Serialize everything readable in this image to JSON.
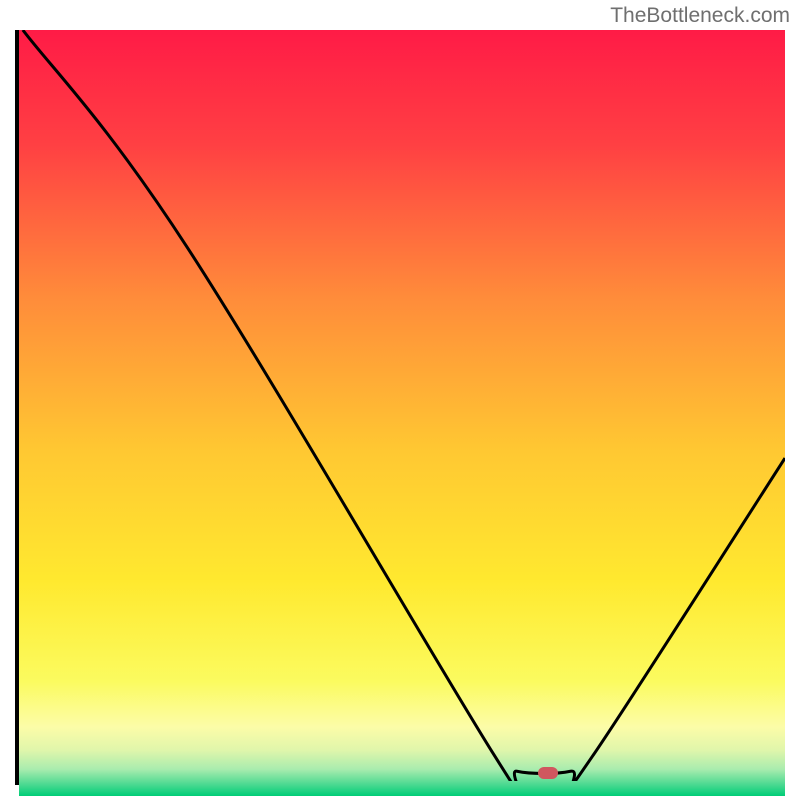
{
  "watermark": "TheBottleneck.com",
  "chart_data": {
    "type": "line",
    "title": "",
    "xlabel": "",
    "ylabel": "",
    "x_range": [
      0,
      100
    ],
    "y_range": [
      0,
      100
    ],
    "series": [
      {
        "name": "bottleneck-curve",
        "points": [
          {
            "x": 0.5,
            "y": 100
          },
          {
            "x": 22,
            "y": 71
          },
          {
            "x": 62,
            "y": 3.5
          },
          {
            "x": 65,
            "y": 1.3
          },
          {
            "x": 72,
            "y": 1.3
          },
          {
            "x": 75,
            "y": 3.5
          },
          {
            "x": 100,
            "y": 43
          }
        ]
      }
    ],
    "marker": {
      "x": 69,
      "y": 1
    },
    "background_gradient": {
      "stops": [
        {
          "offset": 0,
          "color": "#ff1b46"
        },
        {
          "offset": 15,
          "color": "#ff4043"
        },
        {
          "offset": 35,
          "color": "#ff8c3a"
        },
        {
          "offset": 55,
          "color": "#ffc832"
        },
        {
          "offset": 72,
          "color": "#ffe92f"
        },
        {
          "offset": 85,
          "color": "#fbfb5f"
        },
        {
          "offset": 91,
          "color": "#fcfca8"
        },
        {
          "offset": 94,
          "color": "#e0f6ab"
        },
        {
          "offset": 96.5,
          "color": "#a9ecae"
        },
        {
          "offset": 98.5,
          "color": "#4bd991"
        },
        {
          "offset": 100,
          "color": "#00cd77"
        }
      ]
    }
  }
}
